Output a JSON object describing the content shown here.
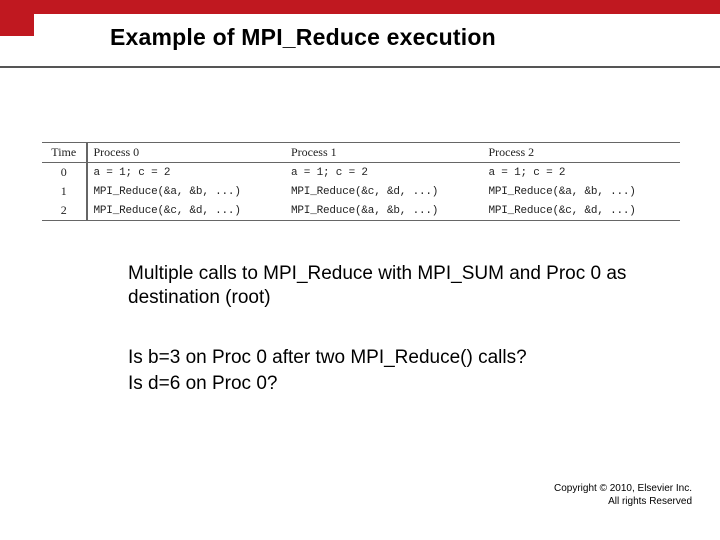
{
  "title": "Example  of MPI_Reduce execution",
  "table": {
    "headers": {
      "time": "Time",
      "p0": "Process 0",
      "p1": "Process 1",
      "p2": "Process 2"
    },
    "rows": [
      {
        "t": "0",
        "p0": "a = 1;  c = 2",
        "p1": "a = 1;  c = 2",
        "p2": "a = 1;  c = 2"
      },
      {
        "t": "1",
        "p0": "MPI_Reduce(&a, &b, ...)",
        "p1": "MPI_Reduce(&c, &d, ...)",
        "p2": "MPI_Reduce(&a, &b, ...)"
      },
      {
        "t": "2",
        "p0": "MPI_Reduce(&c, &d, ...)",
        "p1": "MPI_Reduce(&a, &b, ...)",
        "p2": "MPI_Reduce(&c, &d, ...)"
      }
    ]
  },
  "body": {
    "line1": "Multiple calls to MPI_Reduce with MPI_SUM and Proc 0 as destination (root)",
    "line2": "Is b=3  on Proc 0 after two MPI_Reduce() calls?",
    "line3": "Is d=6 on Proc 0?"
  },
  "copyright": {
    "line1": "Copyright © 2010, Elsevier Inc.",
    "line2": "All rights Reserved"
  }
}
